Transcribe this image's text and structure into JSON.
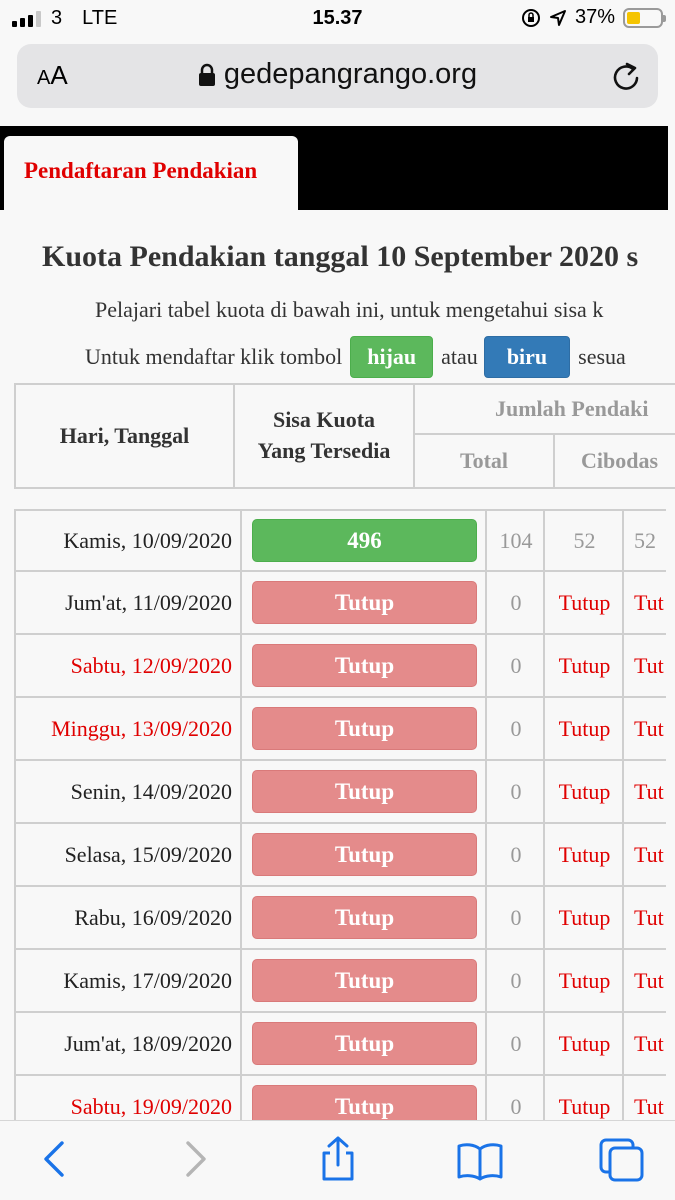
{
  "status": {
    "carrier": "3",
    "network": "LTE",
    "time": "15.37",
    "battery": "37%"
  },
  "browser": {
    "text_size_label": "AA",
    "url": "gedepangrango.org"
  },
  "site": {
    "tab_label": "Pendaftaran Pendakian",
    "heading": "Kuota Pendakian tanggal 10 September 2020 s",
    "intro_line1": "Pelajari tabel kuota di bawah ini, untuk mengetahui sisa k",
    "intro_prefix": "Untuk mendaftar klik tombol",
    "green_button": "hijau",
    "intro_or": "atau",
    "blue_button": "biru",
    "intro_suffix": "sesua"
  },
  "table": {
    "headers": {
      "day": "Hari, Tanggal",
      "quota_line1": "Sisa Kuota",
      "quota_line2": "Yang Tersedia",
      "group": "Jumlah Pendaki",
      "total": "Total",
      "cibodas": "Cibodas"
    },
    "rows": [
      {
        "day": "Kamis, 10/09/2020",
        "quota": "496",
        "total": "104",
        "cibodas": "52",
        "next": "52"
      },
      {
        "day": "Jum'at, 11/09/2020",
        "quota": "Tutup",
        "total": "0",
        "cibodas": "Tutup",
        "next": "Tut"
      },
      {
        "day": "Sabtu, 12/09/2020",
        "quota": "Tutup",
        "total": "0",
        "cibodas": "Tutup",
        "next": "Tut"
      },
      {
        "day": "Minggu, 13/09/2020",
        "quota": "Tutup",
        "total": "0",
        "cibodas": "Tutup",
        "next": "Tut"
      },
      {
        "day": "Senin, 14/09/2020",
        "quota": "Tutup",
        "total": "0",
        "cibodas": "Tutup",
        "next": "Tut"
      },
      {
        "day": "Selasa, 15/09/2020",
        "quota": "Tutup",
        "total": "0",
        "cibodas": "Tutup",
        "next": "Tut"
      },
      {
        "day": "Rabu, 16/09/2020",
        "quota": "Tutup",
        "total": "0",
        "cibodas": "Tutup",
        "next": "Tut"
      },
      {
        "day": "Kamis, 17/09/2020",
        "quota": "Tutup",
        "total": "0",
        "cibodas": "Tutup",
        "next": "Tut"
      },
      {
        "day": "Jum'at, 18/09/2020",
        "quota": "Tutup",
        "total": "0",
        "cibodas": "Tutup",
        "next": "Tut"
      },
      {
        "day": "Sabtu, 19/09/2020",
        "quota": "Tutup",
        "total": "0",
        "cibodas": "Tutup",
        "next": "Tut"
      }
    ]
  },
  "colors": {
    "accent_red": "#e00000",
    "open_green": "#5cb85c",
    "closed_red": "#e48b8b",
    "link_blue": "#337ab7",
    "ios_blue": "#1a73e8"
  },
  "icons": [
    "signal-icon",
    "orientation-lock-icon",
    "location-icon",
    "battery-icon",
    "lock-icon",
    "reload-icon",
    "back-icon",
    "forward-icon",
    "share-icon",
    "bookmarks-icon",
    "tabs-icon"
  ]
}
